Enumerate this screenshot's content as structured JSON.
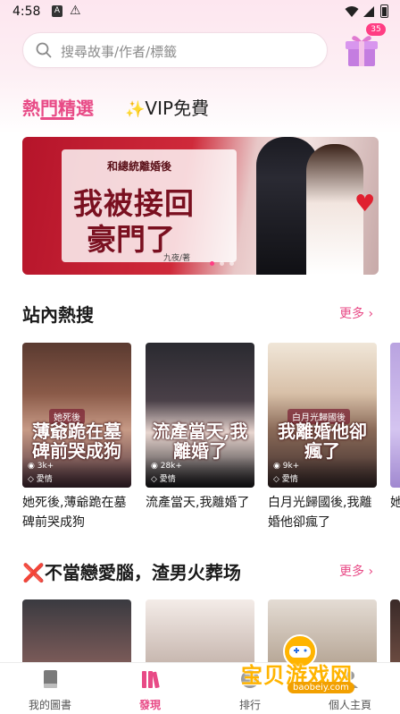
{
  "status_bar": {
    "time": "4:58",
    "notif_letter": "A"
  },
  "search": {
    "placeholder": "搜尋故事/作者/標籤"
  },
  "gift": {
    "badge_count": "35"
  },
  "tabs": [
    {
      "label": "熱門精選",
      "active": true
    },
    {
      "label": "VIP免費",
      "active": false
    }
  ],
  "banner": {
    "subtitle": "和總統離婚後",
    "title_line1": "我被接回",
    "title_line2": "豪門了",
    "author": "九夜/著",
    "slide_count": 3,
    "active_slide": 0
  },
  "section_hot": {
    "title": "站內熱搜",
    "more_label": "更多"
  },
  "hot_books": [
    {
      "cover_small": "她死後",
      "cover_text": "薄爺跪在墓碑前哭成狗",
      "views": "3k+",
      "tag": "愛情",
      "title": "她死後,薄爺跪在墓碑前哭成狗"
    },
    {
      "cover_small": "",
      "cover_text": "流產當天,我離婚了",
      "views": "28k+",
      "tag": "愛情",
      "title": "流產當天,我離婚了"
    },
    {
      "cover_small": "白月光歸國後",
      "cover_text": "我離婚他卻瘋了",
      "views": "9k+",
      "tag": "愛情",
      "title": "白月光歸國後,我離婚他卻瘋了"
    },
    {
      "cover_small": "",
      "cover_text": "",
      "views": "",
      "tag": "",
      "title": "她"
    }
  ],
  "section_second": {
    "title_icon": "❌",
    "title": "不當戀愛腦，渣男火葬场",
    "more_label": "更多"
  },
  "bottom_nav": [
    {
      "label": "我的圖書",
      "icon": "book-icon",
      "active": false
    },
    {
      "label": "發現",
      "icon": "discover-icon",
      "active": true
    },
    {
      "label": "排行",
      "icon": "ranking-icon",
      "active": false
    },
    {
      "label": "個人主頁",
      "icon": "profile-icon",
      "active": false
    }
  ],
  "watermark": {
    "text": "宝贝游戏网",
    "url": "baobeiy.com"
  },
  "colors": {
    "accent": "#e84a86",
    "badge": "#ff3d83"
  }
}
